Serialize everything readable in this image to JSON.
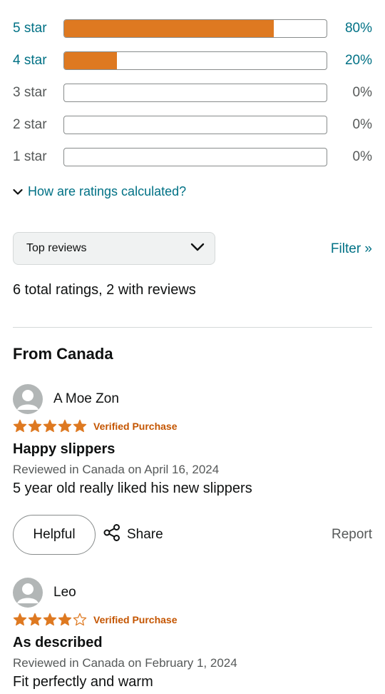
{
  "histogram": [
    {
      "label": "5 star",
      "percent_text": "80%",
      "fill_percent": 80,
      "is_link": true
    },
    {
      "label": "4 star",
      "percent_text": "20%",
      "fill_percent": 20,
      "is_link": true
    },
    {
      "label": "3 star",
      "percent_text": "0%",
      "fill_percent": 0,
      "is_link": false
    },
    {
      "label": "2 star",
      "percent_text": "0%",
      "fill_percent": 0,
      "is_link": false
    },
    {
      "label": "1 star",
      "percent_text": "0%",
      "fill_percent": 0,
      "is_link": false
    }
  ],
  "calc_link": "How are ratings calculated?",
  "sort": {
    "selected": "Top reviews"
  },
  "filter_label": "Filter »",
  "total_ratings": "6 total ratings, 2 with reviews",
  "section_title": "From Canada",
  "reviews": [
    {
      "name": "A Moe Zon",
      "stars": 5,
      "verified": "Verified Purchase",
      "title": "Happy slippers",
      "date": "Reviewed in Canada on April 16, 2024",
      "body": "5 year old really liked his new slippers"
    },
    {
      "name": "Leo",
      "stars": 4,
      "verified": "Verified Purchase",
      "title": "As described",
      "date": "Reviewed in Canada on February 1, 2024",
      "body": "Fit perfectly and warm"
    }
  ],
  "actions": {
    "helpful": "Helpful",
    "share": "Share",
    "report": "Report"
  },
  "colors": {
    "accent_link": "#007185",
    "bar_fill": "#de7921",
    "star": "#de7921",
    "verified": "#c45500"
  },
  "icons": {
    "calc_chevron": "chevron-down-icon",
    "sort_chevron": "chevron-down-icon",
    "share": "share-icon",
    "avatar": "user-avatar-icon",
    "star": "star-icon"
  }
}
